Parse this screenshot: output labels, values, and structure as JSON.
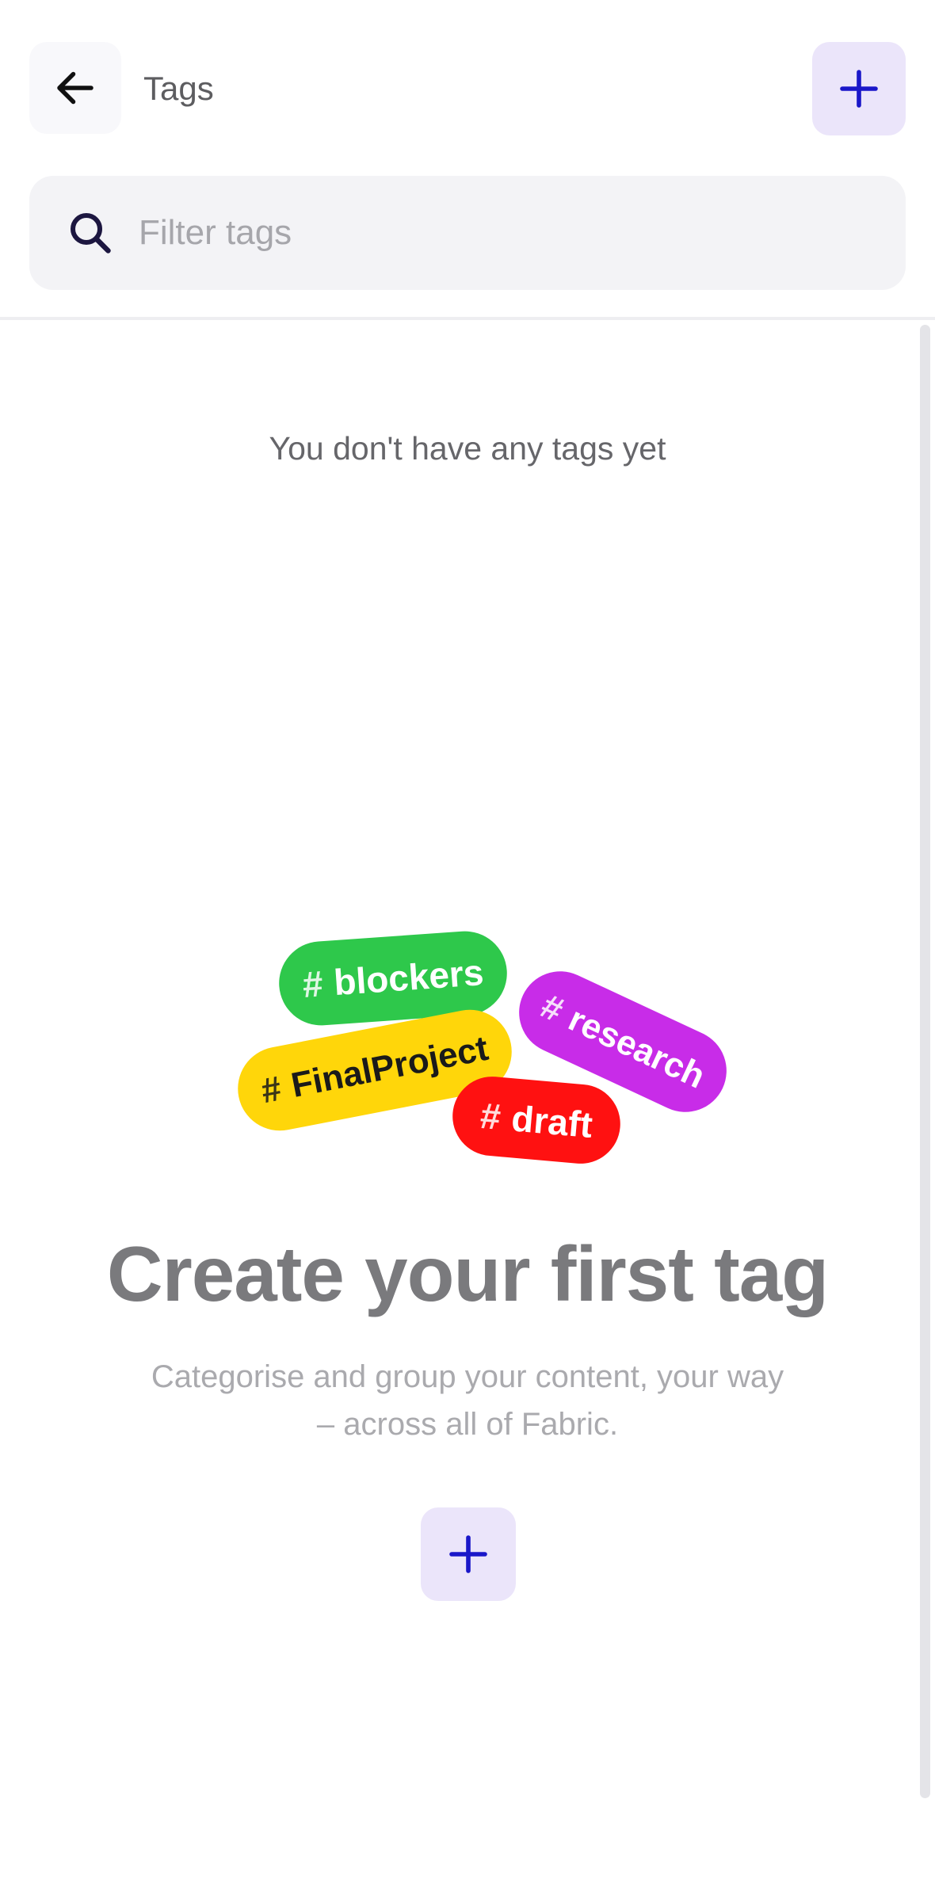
{
  "header": {
    "title": "Tags",
    "back_icon": "arrow-left-icon",
    "add_icon": "plus-icon"
  },
  "search": {
    "placeholder": "Filter tags",
    "value": "",
    "icon": "search-icon"
  },
  "empty_state": {
    "message": "You don't have any tags yet",
    "illustration_tags": [
      {
        "hash": "#",
        "label": "blockers",
        "color": "#2ec84b"
      },
      {
        "hash": "#",
        "label": "FinalProject",
        "color": "#ffd60a"
      },
      {
        "hash": "#",
        "label": "research",
        "color": "#c82ce8"
      },
      {
        "hash": "#",
        "label": "draft",
        "color": "#ff1111"
      }
    ],
    "headline": "Create your first tag",
    "subtext_line1": "Categorise and group your content, your way",
    "subtext_line2": "– across all of Fabric.",
    "add_icon": "plus-icon"
  },
  "colors": {
    "accent": "#1a17c9",
    "accent_bg": "#ebe5fa",
    "search_bg": "#f3f3f6"
  }
}
